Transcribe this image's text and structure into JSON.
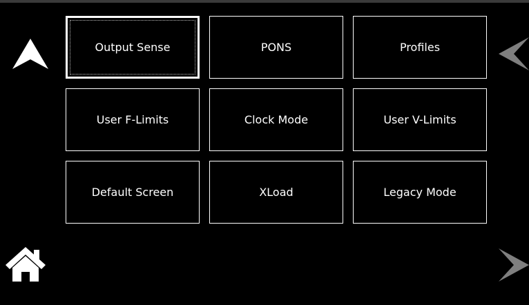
{
  "menu": {
    "buttons": [
      {
        "label": "Output Sense",
        "selected": true
      },
      {
        "label": "PONS",
        "selected": false
      },
      {
        "label": "Profiles",
        "selected": false
      },
      {
        "label": "User F-Limits",
        "selected": false
      },
      {
        "label": "Clock Mode",
        "selected": false
      },
      {
        "label": "User V-Limits",
        "selected": false
      },
      {
        "label": "Default Screen",
        "selected": false
      },
      {
        "label": "XLoad",
        "selected": false
      },
      {
        "label": "Legacy Mode",
        "selected": false
      }
    ]
  },
  "nav": {
    "up_icon": "arrow-up-icon",
    "prev_icon": "chevron-left-icon",
    "home_icon": "home-icon",
    "next_icon": "chevron-right-icon"
  },
  "colors": {
    "background": "#000000",
    "button_border": "#ffffff",
    "text": "#ffffff",
    "nav_primary": "#ffffff",
    "nav_disabled": "#7f7f7f"
  }
}
